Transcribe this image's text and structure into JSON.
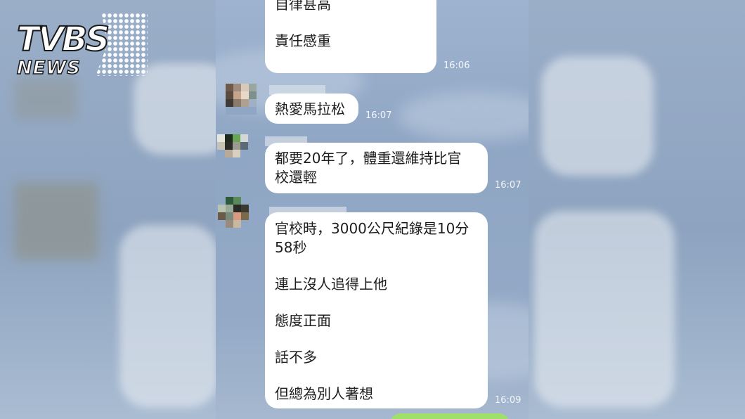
{
  "watermark": {
    "brand": "TVBS",
    "sub": "NEWS"
  },
  "messages": [
    {
      "lines": [
        "自律甚高",
        "",
        "責任感重"
      ],
      "time": "16:06"
    },
    {
      "lines": [
        "熱愛馬拉松"
      ],
      "time": "16:07"
    },
    {
      "lines": [
        "都要20年了，體重還維持比官",
        "校還輕"
      ],
      "time": "16:07"
    },
    {
      "lines": [
        "官校時，3000公尺紀錄是10分",
        "58秒",
        "",
        "連上沒人追得上他",
        "",
        "態度正面",
        "",
        "話不多",
        "",
        "但總為別人著想"
      ],
      "time": "16:09"
    }
  ],
  "colors": {
    "bubble": "#ffffff",
    "sent_bubble": "#9fe06b",
    "chat_bg": "#93a9c6"
  }
}
